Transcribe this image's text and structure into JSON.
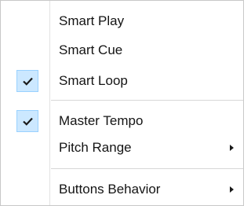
{
  "menu": {
    "items": [
      {
        "label": "Smart Play",
        "checked": false,
        "submenu": false
      },
      {
        "label": "Smart Cue",
        "checked": false,
        "submenu": false
      },
      {
        "label": "Smart Loop",
        "checked": true,
        "submenu": false
      },
      {
        "label": "Master Tempo",
        "checked": true,
        "submenu": false
      },
      {
        "label": "Pitch Range",
        "checked": false,
        "submenu": true
      },
      {
        "label": "Buttons Behavior",
        "checked": false,
        "submenu": true
      }
    ]
  },
  "colors": {
    "check_highlight": "#cce8ff",
    "check_border": "#99d1ff",
    "text": "#141414"
  },
  "icons": {
    "check": "checkmark-icon",
    "submenu": "submenu-arrow-icon"
  }
}
